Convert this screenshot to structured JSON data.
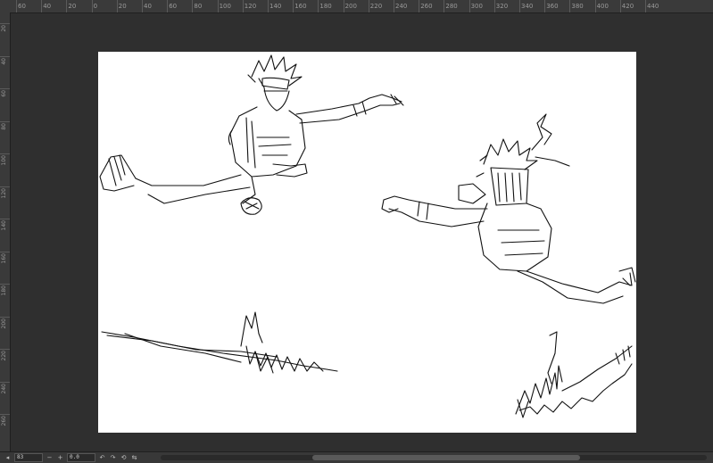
{
  "ruler_top": {
    "labels": [
      "60",
      "40",
      "20",
      "0",
      "20",
      "40",
      "60",
      "80",
      "100",
      "120",
      "140",
      "160",
      "180",
      "200",
      "220",
      "240",
      "260",
      "280",
      "300",
      "320",
      "340",
      "360",
      "380",
      "400",
      "420",
      "440"
    ]
  },
  "ruler_left": {
    "labels": [
      "20",
      "40",
      "60",
      "80",
      "100",
      "120",
      "140",
      "160",
      "180",
      "200",
      "220",
      "240",
      "260"
    ]
  },
  "statusbar": {
    "zoom_value": "83",
    "angle_value": "0.0",
    "zoom_out_label": "−",
    "zoom_in_label": "+",
    "rotate_left_label": "↶",
    "rotate_right_label": "↷",
    "reset_label": "⟲",
    "flip_label": "⇆"
  },
  "colors": {
    "workspace_bg": "#2f2f2f",
    "paper": "#ffffff",
    "ink": "#111111"
  }
}
